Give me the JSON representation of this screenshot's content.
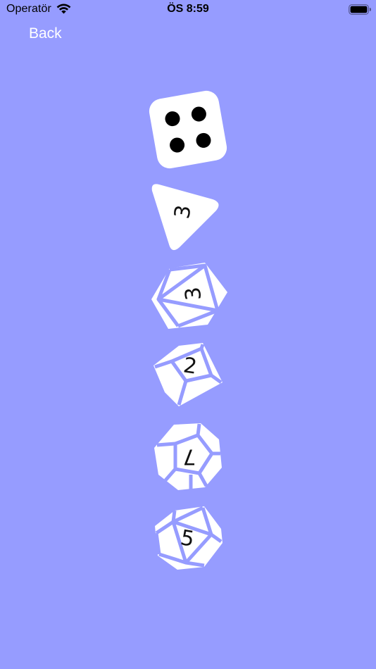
{
  "status_bar": {
    "carrier": "Operatör",
    "time": "ÖS 8:59"
  },
  "nav": {
    "back_label": "Back"
  },
  "dice": [
    {
      "type": "d6",
      "value": 4
    },
    {
      "type": "d4",
      "value": "3"
    },
    {
      "type": "d8",
      "value": "3"
    },
    {
      "type": "d10",
      "value": "2"
    },
    {
      "type": "d12",
      "value": "7"
    },
    {
      "type": "d20",
      "value": "5"
    }
  ],
  "colors": {
    "background": "#969cff",
    "die_face": "#ffffff",
    "die_edge": "#969cff",
    "pip": "#000000"
  }
}
